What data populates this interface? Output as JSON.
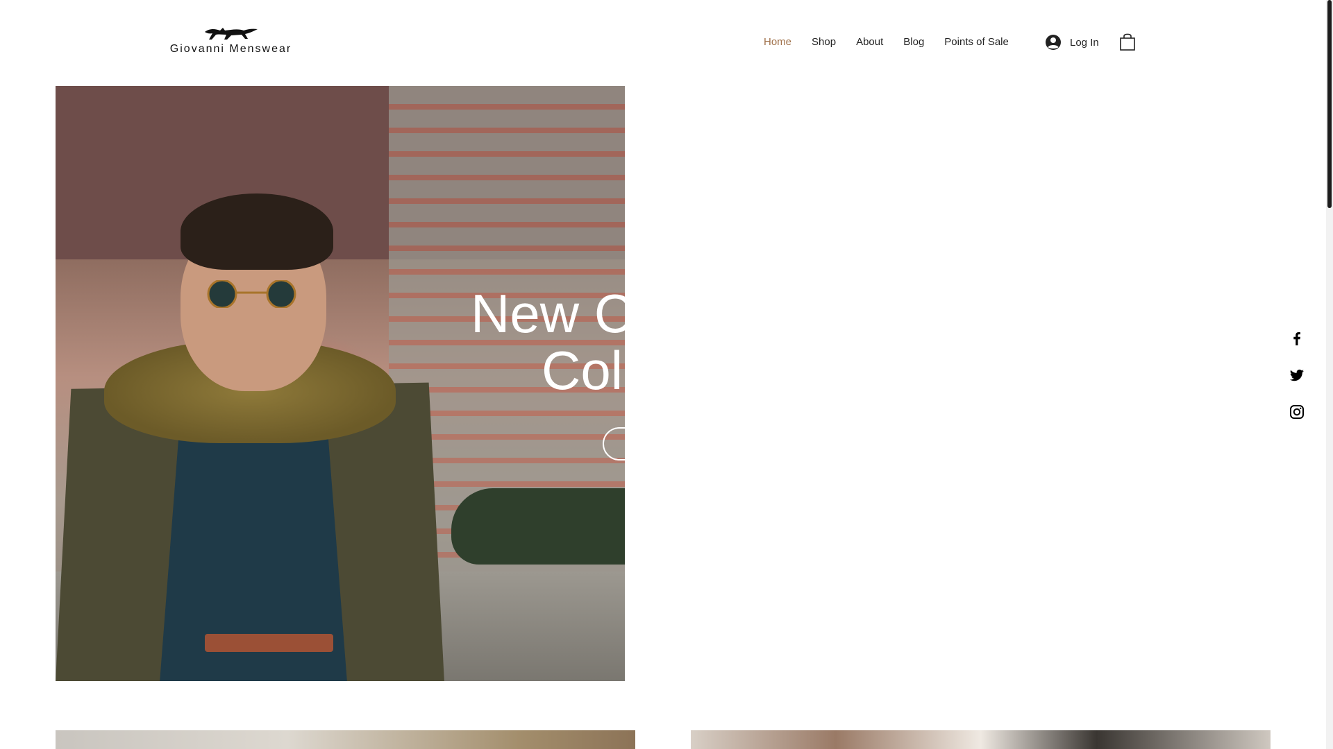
{
  "header": {
    "brand": "Giovanni Menswear",
    "logo_icon": "fox-icon",
    "nav": [
      {
        "label": "Home",
        "active": true
      },
      {
        "label": "Shop",
        "active": false
      },
      {
        "label": "About",
        "active": false
      },
      {
        "label": "Blog",
        "active": false
      },
      {
        "label": "Points of Sale",
        "active": false
      }
    ],
    "login_label": "Log In",
    "cart_icon": "shopping-bag-icon",
    "active_color": "#a0714a"
  },
  "hero": {
    "title_line1": "New C",
    "title_line2": "Col",
    "text_color": "#ffffff"
  },
  "social": [
    "facebook-icon",
    "twitter-icon",
    "instagram-icon"
  ]
}
